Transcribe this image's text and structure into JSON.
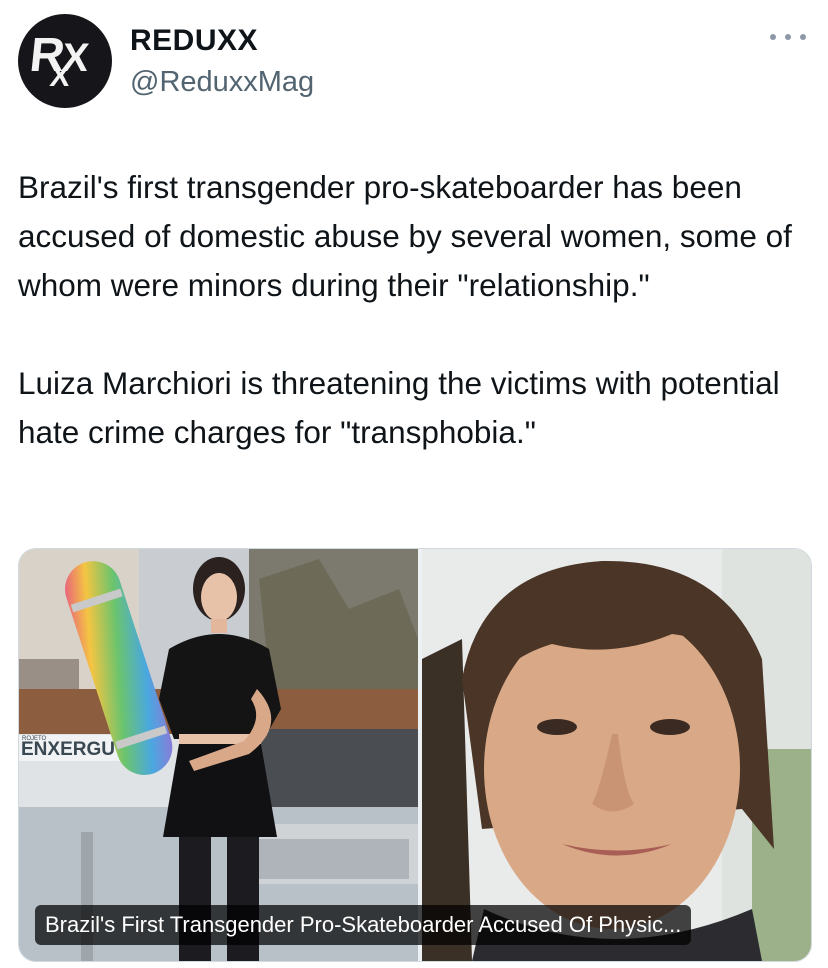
{
  "author": {
    "display_name": "REDUXX",
    "handle": "@ReduxxMag",
    "avatar_letters": {
      "r": "R",
      "x1": "X",
      "x2": "X"
    }
  },
  "tweet": {
    "paragraphs": [
      "Brazil's first transgender pro-skateboarder has been accused of domestic abuse by several women, some of whom were minors during their \"relationship.\"",
      "Luiza Marchiori is threatening the victims with potential hate crime charges for \"transphobia.\""
    ]
  },
  "media": {
    "caption": "Brazil's First Transgender Pro-Skateboarder Accused Of Physic...",
    "photo_left": {
      "sign_text": "ENXERGU",
      "sign_small": "ROJETO"
    }
  },
  "icons": {
    "more": "more-horizontal-icon"
  },
  "colors": {
    "text": "#0f1419",
    "secondary": "#536471",
    "border": "#cfd9de"
  }
}
